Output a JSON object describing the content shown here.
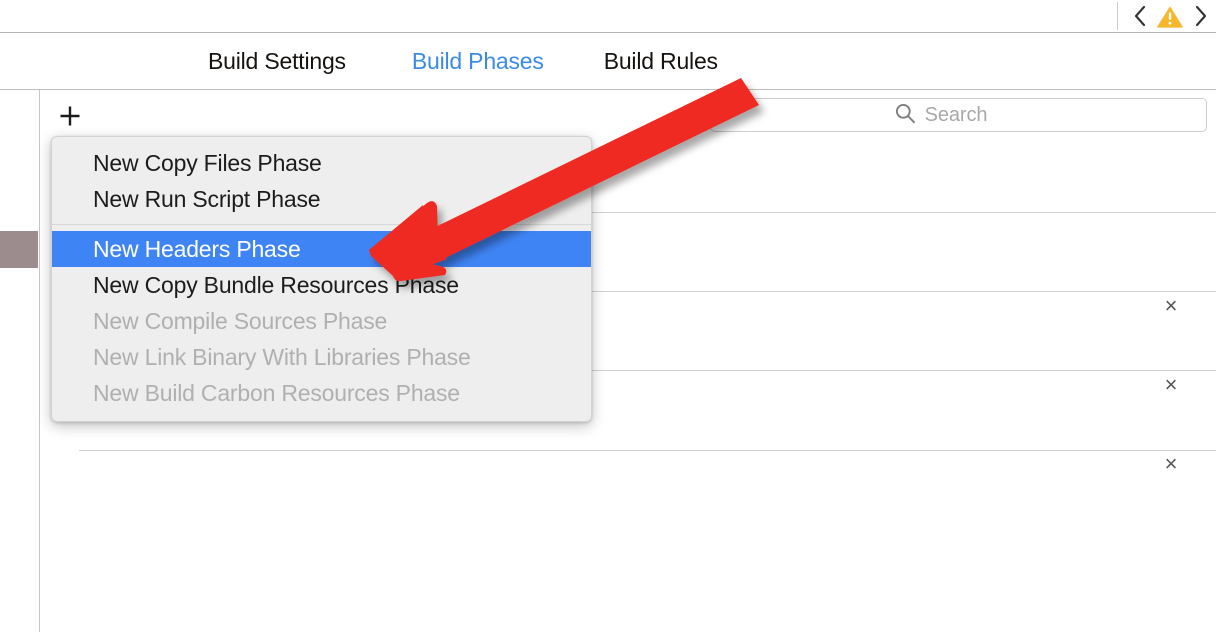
{
  "toolbar": {
    "back_icon": "chevron-left-icon",
    "warning_icon": "warning-triangle-icon",
    "forward_icon": "chevron-right-icon",
    "warning_color": "#f5b426"
  },
  "tabs": [
    {
      "label": "Build Settings",
      "active": false
    },
    {
      "label": "Build Phases",
      "active": true
    },
    {
      "label": "Build Rules",
      "active": false
    }
  ],
  "tab_active_color": "#3b8ae8",
  "phase_bar": {
    "add_button_label": "+",
    "add_button_icon": "plus-icon"
  },
  "search": {
    "icon": "search-icon",
    "placeholder": "Search",
    "value": ""
  },
  "rows": [
    {
      "remove_icon": "close-icon",
      "remove_label": "×"
    },
    {
      "remove_icon": "close-icon",
      "remove_label": "×"
    },
    {
      "remove_icon": "close-icon",
      "remove_label": "×"
    }
  ],
  "menu": {
    "highlight_color": "#3f84f5",
    "items": [
      {
        "label": "New Copy Files Phase",
        "state": "enabled"
      },
      {
        "label": "New Run Script Phase",
        "state": "enabled"
      },
      {
        "label": "New Headers Phase",
        "state": "selected"
      },
      {
        "label": "New Copy Bundle Resources Phase",
        "state": "enabled"
      },
      {
        "label": "New Compile Sources Phase",
        "state": "disabled"
      },
      {
        "label": "New Link Binary With Libraries Phase",
        "state": "disabled"
      },
      {
        "label": "New Build Carbon Resources Phase",
        "state": "disabled"
      }
    ]
  },
  "annotation": {
    "type": "arrow",
    "color": "#ee2b20",
    "points_to": "New Headers Phase"
  }
}
